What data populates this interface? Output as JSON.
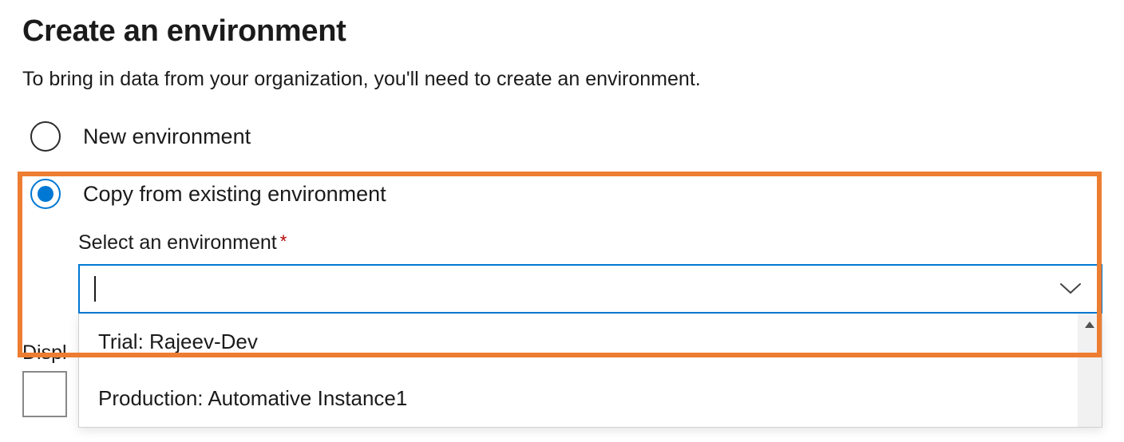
{
  "title": "Create an environment",
  "subtitle": "To bring in data from your organization, you'll need to create an environment.",
  "radios": {
    "new_env": {
      "label": "New environment",
      "selected": false
    },
    "copy_env": {
      "label": "Copy from existing environment",
      "selected": true
    }
  },
  "select_field": {
    "label": "Select an environment",
    "required_marker": "*",
    "value": "",
    "options": [
      "Trial: Rajeev-Dev",
      "Production: Automative Instance1"
    ]
  },
  "display_label_partial": "Displ"
}
